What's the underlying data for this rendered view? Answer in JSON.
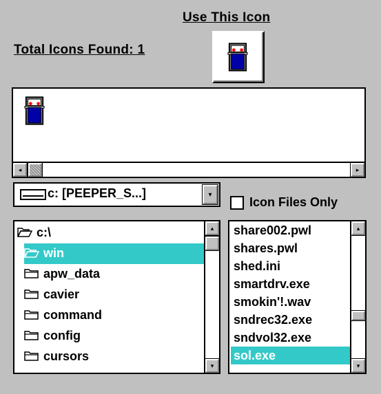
{
  "header": {
    "use_icon_label": "Use This Icon",
    "total_icons_label": "Total Icons Found: 1"
  },
  "icon_strip": {
    "icons": [
      {
        "name": "icon-file-icon"
      }
    ],
    "scrollbar": {
      "left_arrow": "◂",
      "right_arrow": "▸"
    }
  },
  "drive": {
    "selected": "c: [PEEPER_S...]",
    "arrow": "▾"
  },
  "filter": {
    "label": "Icon Files Only",
    "checked": false
  },
  "directories": {
    "items": [
      {
        "label": "c:\\",
        "state": "open",
        "indent": 0
      },
      {
        "label": "win",
        "state": "open",
        "indent": 1,
        "selected": true
      },
      {
        "label": "apw_data",
        "state": "closed",
        "indent": 2
      },
      {
        "label": "cavier",
        "state": "closed",
        "indent": 2
      },
      {
        "label": "command",
        "state": "closed",
        "indent": 2
      },
      {
        "label": "config",
        "state": "closed",
        "indent": 2
      },
      {
        "label": "cursors",
        "state": "closed",
        "indent": 2
      }
    ],
    "up_arrow": "▴",
    "down_arrow": "▾"
  },
  "files": {
    "items": [
      {
        "label": "share002.pwl"
      },
      {
        "label": "shares.pwl"
      },
      {
        "label": "shed.ini"
      },
      {
        "label": "smartdrv.exe"
      },
      {
        "label": "smokin'!.wav"
      },
      {
        "label": "sndrec32.exe"
      },
      {
        "label": "sndvol32.exe"
      },
      {
        "label": "sol.exe",
        "selected": true
      }
    ],
    "up_arrow": "▴",
    "down_arrow": "▾"
  },
  "colors": {
    "window_bg": "#c0c0c0",
    "selection": "#34c9c9",
    "icon_body": "#0000a8",
    "icon_lights": "#ff0000"
  }
}
